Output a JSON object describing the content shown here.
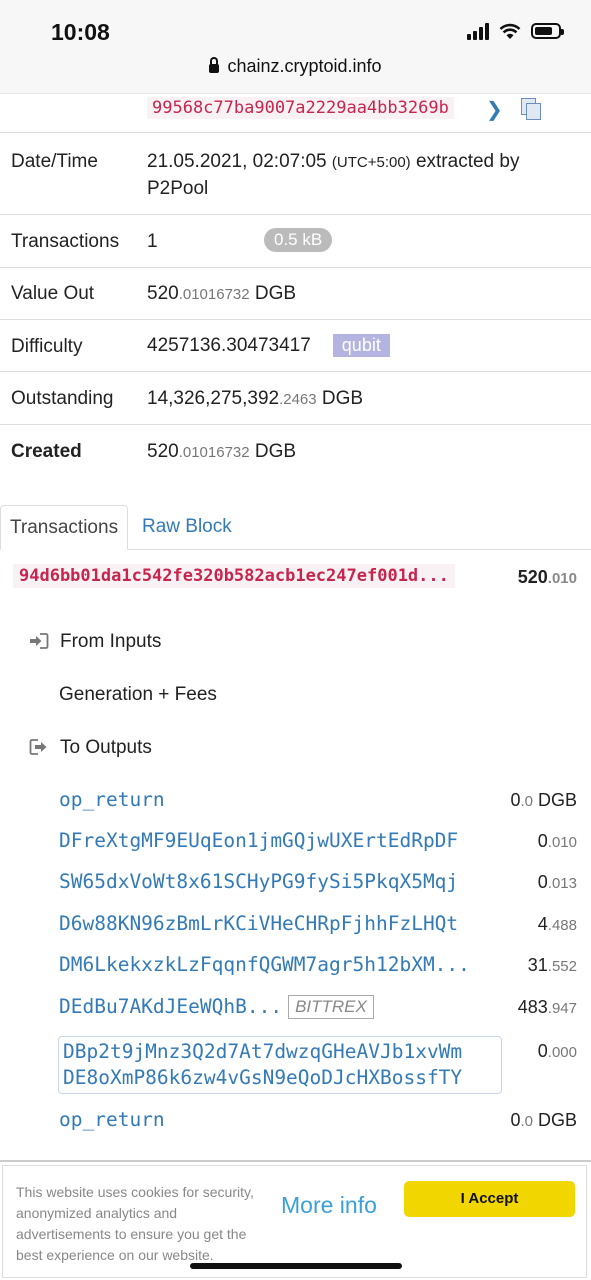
{
  "status_bar": {
    "time": "10:08"
  },
  "browser": {
    "url": "chainz.cryptoid.info"
  },
  "block": {
    "hash_tail": "99568c77ba9007a2229aa4bb3269b",
    "rows": {
      "datetime": {
        "label": "Date/Time",
        "value": "21.05.2021, 02:07:05",
        "tz": "(UTC+5:00)",
        "extracted": "extracted by",
        "pool": "P2Pool"
      },
      "transactions": {
        "label": "Transactions",
        "value": "1",
        "size": "0.5 kB"
      },
      "value_out": {
        "label": "Value Out",
        "int": "520",
        "dec": ".01016732",
        "unit": "DGB"
      },
      "difficulty": {
        "label": "Difficulty",
        "value": "4257136.30473417",
        "algo": "qubit"
      },
      "outstanding": {
        "label": "Outstanding",
        "int": "14,326,275,392",
        "dec": ".2463",
        "unit": "DGB"
      },
      "created": {
        "label": "Created",
        "int": "520",
        "dec": ".01016732",
        "unit": "DGB"
      }
    }
  },
  "tabs": {
    "active": "Transactions",
    "inactive": "Raw Block"
  },
  "tx": {
    "hash": "94d6bb01da1c542fe320b582acb1ec247ef001d...",
    "val_int": "520",
    "val_dec": ".010",
    "from_label": "From Inputs",
    "generation": "Generation + Fees",
    "to_label": "To Outputs",
    "outputs": [
      {
        "address": "op_return",
        "int": "0",
        "dec": ".0",
        "unit": "DGB"
      },
      {
        "address": "DFreXtgMF9EUqEon1jmGQjwUXErtEdRpDF",
        "int": "0",
        "dec": ".010",
        "unit": ""
      },
      {
        "address": "SW65dxVoWt8x61SCHyPG9fySi5PkqX5Mqj",
        "int": "0",
        "dec": ".013",
        "unit": ""
      },
      {
        "address": "D6w88KN96zBmLrKCiVHeCHRpFjhhFzLHQt",
        "int": "4",
        "dec": ".488",
        "unit": ""
      },
      {
        "address": "DM6LkekxzkLzFqqnfQGWM7agr5h12bXM...",
        "int": "31",
        "dec": ".552",
        "unit": ""
      },
      {
        "address": "DEdBu7AKdJEeWQhB...",
        "tag": "BITTREX",
        "int": "483",
        "dec": ".947",
        "unit": ""
      },
      {
        "address_line1": "DBp2t9jMnz3Q2d7At7dwzqGHeAVJb1xvWm",
        "address_line2": "DE8oXmP86k6zw4vGsN9eQoDJcHXBossfTY",
        "int": "0",
        "dec": ".000",
        "unit": ""
      },
      {
        "address": "op_return",
        "int": "0",
        "dec": ".0",
        "unit": "DGB"
      }
    ]
  },
  "cookie": {
    "text": "This website uses cookies for security, anonymized analytics and advertisements to ensure you get the best experience on our website.",
    "more_info": "More info",
    "accept": "I Accept"
  }
}
